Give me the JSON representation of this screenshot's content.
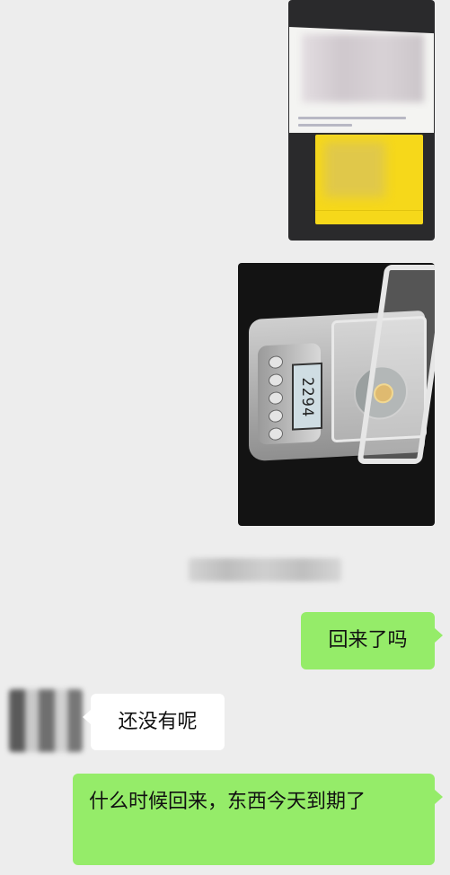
{
  "images": [
    {
      "name": "document-photo",
      "alt": ""
    },
    {
      "name": "scale-photo",
      "scale_reading": "2294"
    }
  ],
  "messages": [
    {
      "side": "right",
      "text": "回来了吗"
    },
    {
      "side": "left",
      "text": "还没有呢"
    },
    {
      "side": "right",
      "text": "什么时候回来，东西今天到期了"
    }
  ],
  "colors": {
    "background": "#ededed",
    "outgoing_bubble": "#95ec69",
    "incoming_bubble": "#ffffff"
  }
}
